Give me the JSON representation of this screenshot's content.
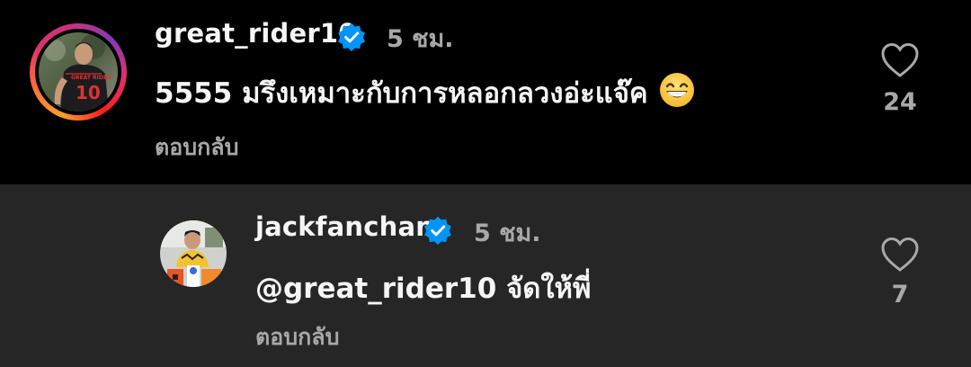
{
  "comments": [
    {
      "username": "great_rider10",
      "verified": true,
      "time": "5 ชม.",
      "text": "5555 มรึงเหมาะกับการหลอกลวงอ่ะแจ๊ค",
      "emoji": "grinning-face-with-smiling-eyes",
      "reply_label": "ตอบกลับ",
      "like_count": "24",
      "avatar_story_ring": true,
      "avatar_jersey_text": "GREAT RIDER",
      "avatar_jersey_number": "10"
    },
    {
      "username": "jackfanchan",
      "verified": true,
      "time": "5 ชม.",
      "text": "@great_rider10 จัดให้พี่",
      "reply_label": "ตอบกลับ",
      "like_count": "7",
      "avatar_story_ring": false
    }
  ],
  "colors": {
    "background_top": "#000000",
    "background_reply": "#262626",
    "text_primary": "#f5f5f5",
    "text_secondary": "#a8a8a8",
    "verified_blue": "#0095f6"
  }
}
